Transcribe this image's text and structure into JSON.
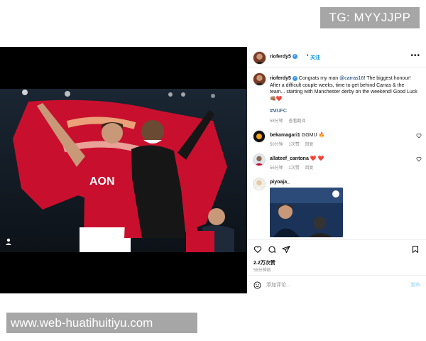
{
  "watermarks": {
    "top": "TG: MYYJJPP",
    "bottom": "www.web-huatihuitiyu.com"
  },
  "header": {
    "username": "rioferdy5",
    "separator": "•",
    "follow_label": "关注",
    "more_icon": "more-horizontal-icon"
  },
  "caption": {
    "username": "rioferdy5",
    "text_before_mention": "Congrats my man ",
    "mention": "@carras16",
    "text_after_mention": "! The biggest honour! After a difficult couple weeks, time to get behind Carras & the team... starting with Manchester derby on the weekend! Good Luck 👊🏽❤️",
    "hashtag": "#MUFC",
    "time": "58分钟",
    "translate": "查看翻译"
  },
  "comments": [
    {
      "username": "bekamagari1",
      "text": "GGMU 🔥",
      "time": "50分钟",
      "likes": "1次赞",
      "reply": "回复"
    },
    {
      "username": "allateef_cantona",
      "text": "❤️ ❤️",
      "time": "56分钟",
      "likes": "1次赞",
      "reply": "回复"
    },
    {
      "username": "piyoaja_",
      "text": "",
      "time": "",
      "likes": "",
      "reply": ""
    }
  ],
  "actions": {
    "likes": "2.2万次赞",
    "time": "58分钟前"
  },
  "add_comment": {
    "placeholder": "添加评论...",
    "post_label": "发布"
  },
  "colors": {
    "link_blue": "#0095f6",
    "mention_blue": "#00376b",
    "kit_red": "#c8102e",
    "meta_gray": "#8e8e8e"
  }
}
